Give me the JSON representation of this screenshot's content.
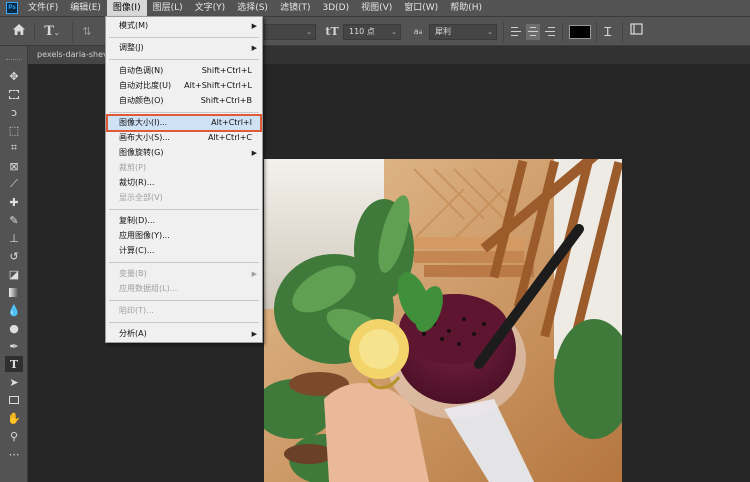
{
  "menubar": {
    "logo": "Ps",
    "items": [
      "文件(F)",
      "编辑(E)",
      "图像(I)",
      "图层(L)",
      "文字(Y)",
      "选择(S)",
      "滤镜(T)",
      "3D(D)",
      "视图(V)",
      "窗口(W)",
      "帮助(H)"
    ],
    "active_index": 2
  },
  "options": {
    "font_size": "110 点",
    "antialias": "犀利",
    "text_color": "#000000"
  },
  "tab": {
    "title": "pexels-daria-shevt"
  },
  "image_menu": {
    "mode": {
      "label": "模式(M)"
    },
    "adjust": {
      "label": "调整(J)"
    },
    "auto_tone": {
      "label": "自动色调(N)",
      "shortcut": "Shift+Ctrl+L"
    },
    "auto_contrast": {
      "label": "自动对比度(U)",
      "shortcut": "Alt+Shift+Ctrl+L"
    },
    "auto_color": {
      "label": "自动颜色(O)",
      "shortcut": "Shift+Ctrl+B"
    },
    "image_size": {
      "label": "图像大小(I)...",
      "shortcut": "Alt+Ctrl+I"
    },
    "canvas_size": {
      "label": "画布大小(S)...",
      "shortcut": "Alt+Ctrl+C"
    },
    "image_rotation": {
      "label": "图像旋转(G)"
    },
    "crop": {
      "label": "裁剪(P)"
    },
    "trim": {
      "label": "裁切(R)..."
    },
    "reveal_all": {
      "label": "显示全部(V)"
    },
    "duplicate": {
      "label": "复制(D)..."
    },
    "apply_image": {
      "label": "应用图像(Y)..."
    },
    "calculations": {
      "label": "计算(C)..."
    },
    "variables": {
      "label": "变量(B)"
    },
    "apply_data_set": {
      "label": "应用数据组(L)..."
    },
    "trap": {
      "label": "陷印(T)..."
    },
    "analysis": {
      "label": "分析(A)"
    }
  },
  "colors": {
    "highlight_border": "#e05a38",
    "highlight_fill": "#cfe1f5",
    "ps_blue": "#31a8ff"
  },
  "icons": {
    "home": "home-icon",
    "text_tool": "type-tool-icon",
    "font_size": "font-size-icon",
    "warp": "warp-text-icon",
    "panel": "character-panel-icon"
  }
}
